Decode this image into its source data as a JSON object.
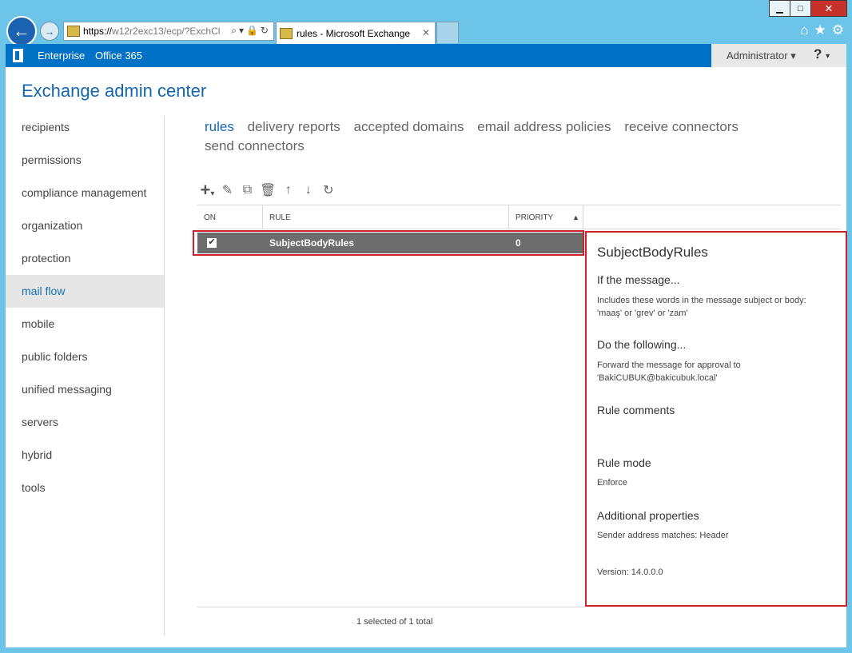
{
  "browser": {
    "url_host": "https://",
    "url_rest": "w12r2exc13/ecp/?ExchCl",
    "tab_title": "rules - Microsoft Exchange"
  },
  "o365": {
    "enterprise": "Enterprise",
    "office365": "Office 365",
    "admin": "Administrator",
    "help": "?"
  },
  "app": {
    "title": "Exchange admin center"
  },
  "nav": {
    "items": [
      "recipients",
      "permissions",
      "compliance management",
      "organization",
      "protection",
      "mail flow",
      "mobile",
      "public folders",
      "unified messaging",
      "servers",
      "hybrid",
      "tools"
    ],
    "selected_index": 5
  },
  "subtabs": [
    "rules",
    "delivery reports",
    "accepted domains",
    "email address policies",
    "receive connectors",
    "send connectors"
  ],
  "grid": {
    "columns": [
      "ON",
      "RULE",
      "PRIORITY"
    ],
    "sort_indicator": "▲",
    "rows": [
      {
        "on": "✔",
        "rule": "SubjectBodyRules",
        "priority": "0"
      }
    ],
    "status": "1 selected of 1 total"
  },
  "details": {
    "title": "SubjectBodyRules",
    "if_heading": "If the message...",
    "if_text_1": "Includes these words in the message subject or body:",
    "if_text_2": "'maaş' or 'grev' or 'zam'",
    "do_heading": "Do the following...",
    "do_text_1": "Forward the message for approval to",
    "do_text_2": "'BakiCUBUK@bakicubuk.local'",
    "comments_heading": "Rule comments",
    "mode_heading": "Rule mode",
    "mode_value": "Enforce",
    "props_heading": "Additional properties",
    "props_value": "Sender address matches: Header",
    "version": "Version: 14.0.0.0"
  }
}
